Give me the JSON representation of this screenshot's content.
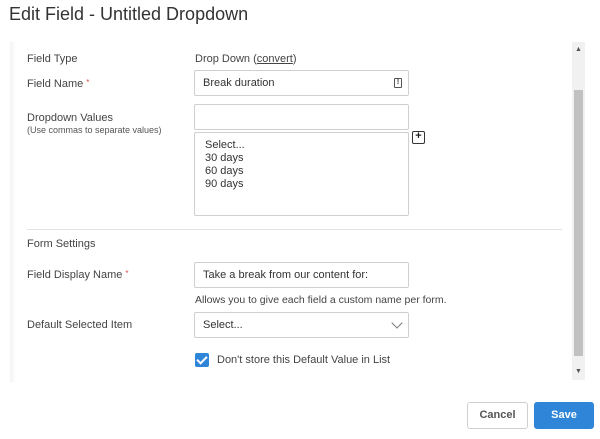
{
  "window": {
    "title": "Edit Field - Untitled Dropdown"
  },
  "field_type": {
    "label": "Field Type",
    "value": "Drop Down",
    "convert_link": "convert"
  },
  "field_name": {
    "label": "Field Name",
    "required_mark": "*",
    "value": "Break duration"
  },
  "dropdown_values": {
    "label": "Dropdown Values",
    "hint": "(Use commas to separate values)",
    "input_value": "",
    "list": [
      "Select...",
      "30 days",
      "60 days",
      "90 days"
    ]
  },
  "form_settings": {
    "heading": "Form Settings",
    "display_name": {
      "label": "Field Display Name",
      "required_mark": "*",
      "value": "Take a break from our content for:",
      "help": "Allows you to give each field a custom name per form."
    },
    "default_item": {
      "label": "Default Selected Item",
      "selected": "Select..."
    },
    "dont_store": {
      "label": "Don't store this Default Value in List",
      "checked": true
    }
  },
  "footer": {
    "cancel_label": "Cancel",
    "save_label": "Save"
  },
  "colors": {
    "accent": "#2f86d8",
    "required": "#d9534f"
  },
  "icons": {
    "field_icon": "field-info-icon",
    "add": "plus-icon",
    "select": "chevron-down-icon",
    "check": "check-icon"
  }
}
